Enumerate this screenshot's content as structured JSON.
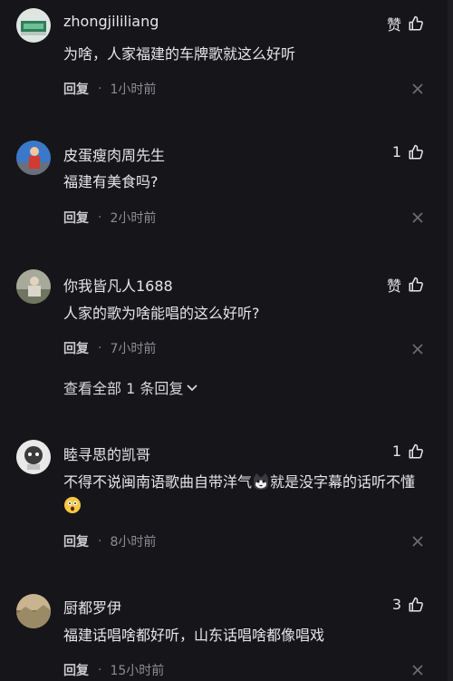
{
  "comments": [
    {
      "username": "zhongjililiang",
      "like_label": "赞",
      "text": "为啥，人家福建的车牌歌就这么好听",
      "reply_label": "回复",
      "time": "1小时前"
    },
    {
      "username": "皮蛋瘦肉周先生",
      "like_label": "1",
      "text": "福建有美食吗?",
      "reply_label": "回复",
      "time": "2小时前"
    },
    {
      "username": "你我皆凡人1688",
      "like_label": "赞",
      "text": "人家的歌为啥能唱的这么好听?",
      "reply_label": "回复",
      "time": "7小时前",
      "expand_label": "查看全部 1 条回复"
    },
    {
      "username": "睦寻思的凯哥",
      "like_label": "1",
      "text_part1": "不得不说闽南语歌曲自带洋气",
      "text_part2": "就是没字幕的话听不懂",
      "emoji1": "cat-face-emoji",
      "emoji2": "astonished-face-emoji",
      "reply_label": "回复",
      "time": "8小时前"
    },
    {
      "username": "厨都罗伊",
      "like_label": "3",
      "text": "福建话唱啥都好听，山东话唱啥都像唱戏",
      "reply_label": "回复",
      "time": "15小时前"
    }
  ],
  "icons": {
    "like": "thumbs-up-icon",
    "close": "close-icon",
    "expand": "chevron-down-icon"
  },
  "colors": {
    "background": "#16161a",
    "text": "#e6e6e8",
    "muted": "#8c8c92"
  }
}
